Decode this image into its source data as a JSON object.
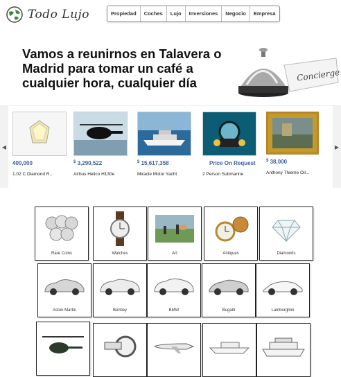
{
  "brand": {
    "name": "Todo Lujo",
    "icon": "globe-logo-icon"
  },
  "nav": [
    "Propiedad",
    "Coches",
    "Lujo",
    "Inversiones",
    "Negocio",
    "Empresa"
  ],
  "hero": {
    "line1": "Vamos a reunirnos en Talavera o",
    "line2": "Madrid para tomar un café a",
    "line3": "cualquier hora, cualquier día",
    "sign_text": "Concierge"
  },
  "carousel": {
    "prev_icon": "chevron-left-icon",
    "next_icon": "chevron-right-icon",
    "items": [
      {
        "currency": "",
        "price": "400,000",
        "title": "1.02 C Diamond R..."
      },
      {
        "currency": "$",
        "price": "3,290,522",
        "title": "Airbus Helico H130e"
      },
      {
        "currency": "$",
        "price": "15,617,358",
        "title": "Miracle Motor Yacht"
      },
      {
        "currency": "",
        "price": "Price On Request",
        "title": "2 Person Submarine"
      },
      {
        "currency": "$",
        "price": "38,000",
        "title": "Anthony Thieme Oil..."
      }
    ]
  },
  "categories": [
    {
      "label": "Rare Coins",
      "icon": "coins-icon"
    },
    {
      "label": "Watches",
      "icon": "watch-icon"
    },
    {
      "label": "Art",
      "icon": "painting-icon"
    },
    {
      "label": "Antiques",
      "icon": "pocket-watch-icon"
    },
    {
      "label": "Diamonds",
      "icon": "diamond-icon"
    },
    {
      "label": "Aston Martin",
      "icon": "car-icon"
    },
    {
      "label": "Bentley",
      "icon": "car-icon"
    },
    {
      "label": "BMW",
      "icon": "car-icon"
    },
    {
      "label": "Bugatti",
      "icon": "car-icon"
    },
    {
      "label": "Lamborghini",
      "icon": "car-icon"
    },
    {
      "label": "",
      "icon": "helicopter-icon"
    },
    {
      "label": "",
      "icon": "motorcycle-icon"
    },
    {
      "label": "",
      "icon": "jet-icon"
    },
    {
      "label": "",
      "icon": "yacht-icon"
    },
    {
      "label": "",
      "icon": "cruise-ship-icon"
    }
  ]
}
